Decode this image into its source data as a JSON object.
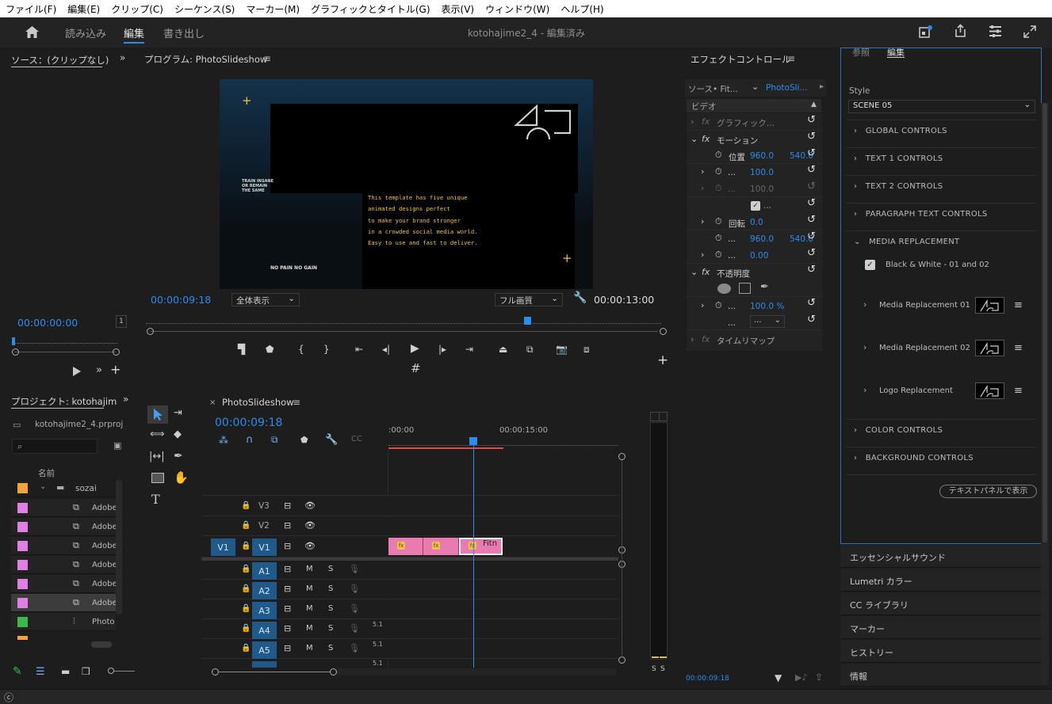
{
  "menu": [
    "ファイル(F)",
    "編集(E)",
    "クリップ(C)",
    "シーケンス(S)",
    "マーカー(M)",
    "グラフィックとタイトル(G)",
    "表示(V)",
    "ウィンドウ(W)",
    "ヘルプ(H)"
  ],
  "header": {
    "tabs": [
      "読み込み",
      "編集",
      "書き出し"
    ],
    "title": "kotohajime2_4 - 編集済み"
  },
  "source": {
    "title": "ソース：(クリップなし)",
    "timecode": "00:00:00:00",
    "zoom": "1"
  },
  "program": {
    "title": "プログラム: PhotoSlideshow",
    "timecode": "00:00:09:18",
    "fit": "全体表示",
    "quality": "フル画質",
    "duration": "00:00:13:00",
    "playhead_fraction": 0.737,
    "preview": {
      "train_lines": [
        "TRAIN INSANE",
        "OR REMAIN",
        "THE SAME"
      ],
      "paragraph": [
        "This template has five unique",
        "animated designs perfect",
        "to make your brand stronger",
        "in a crowded social media world.",
        "Easy to use and fast to deliver."
      ],
      "bottom": "NO PAIN NO GAIN"
    }
  },
  "effects": {
    "title": "エフェクトコントロール",
    "source_tab": "ソース• Fit...",
    "seq_tab": "PhotoSli...",
    "video_label": "ビデオ",
    "rows": {
      "graphic": "グラフィック...",
      "motion": "モーション",
      "position": "位置",
      "pos_x": "960.0",
      "pos_y": "540.0",
      "scale": "100.0",
      "scale_w": "100.0",
      "check": "...",
      "rotation_label": "回転",
      "rotation": "0.0",
      "anchor_x": "960.0",
      "anchor_y": "540.0",
      "flicker": "0.00",
      "opacity_label": "不透明度",
      "opacity": "100.0 %",
      "blend": "...",
      "timeremap": "タイムリマップ",
      "dots": "..."
    },
    "timecode": "00:00:09:18"
  },
  "graphics": {
    "tabs": [
      "参照",
      "編集"
    ],
    "style_label": "Style",
    "style_value": "SCENE 05",
    "sections": [
      "GLOBAL CONTROLS",
      "TEXT 1 CONTROLS",
      "TEXT 2 CONTROLS",
      "PARAGRAPH TEXT CONTROLS"
    ],
    "media_section": "MEDIA REPLACEMENT",
    "checkbox_label": "Black & White - 01 and 02",
    "media_items": [
      "Media Replacement 01",
      "Media Replacement 02",
      "Logo Replacement"
    ],
    "sections_after": [
      "COLOR CONTROLS",
      "BACKGROUND CONTROLS"
    ],
    "text_panel_button": "テキストパネルで表示"
  },
  "right_panels": [
    "エッセンシャルサウンド",
    "Lumetri カラー",
    "CC ライブラリ",
    "マーカー",
    "ヒストリー",
    "情報"
  ],
  "project": {
    "title": "プロジェクト: kotohajim",
    "file": "kotohajime2_4.prproj",
    "name_col": "名前",
    "folder": "sozai",
    "items": [
      "Adobe",
      "Adobe",
      "Adobe",
      "Adobe",
      "Adobe",
      "Adobe"
    ],
    "seq_item": "Photo"
  },
  "timeline": {
    "title": "PhotoSlideshow",
    "timecode": "00:00:09:18",
    "ruler": [
      ":00:00",
      "00:00:15:00"
    ],
    "video_tracks": [
      "V3",
      "V2",
      "V1"
    ],
    "audio_tracks": [
      "A1",
      "A2",
      "A3",
      "A4",
      "A5"
    ],
    "source_patch": "V1",
    "m": "M",
    "s": "S",
    "channel": "5.1",
    "clip_name": "Fitn",
    "fx": "fx"
  },
  "meter": {
    "solo": [
      "S",
      "S"
    ]
  },
  "colors": {
    "accent": "#2d8ceb",
    "clip": "#e97bb0",
    "lavender": "#e180e4",
    "orange": "#f4a23b",
    "green": "#3eb74b"
  }
}
